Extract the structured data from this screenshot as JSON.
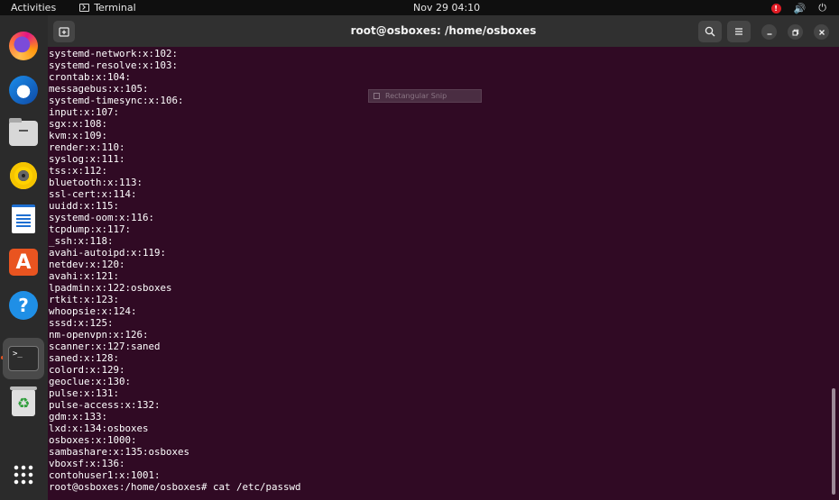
{
  "topbar": {
    "activities": "Activities",
    "app_name": "Terminal",
    "clock": "Nov 29  04:10",
    "tray_alert": "!",
    "volume_symbol": "🔊",
    "power_symbol": "⏻"
  },
  "dock": {
    "items": [
      {
        "name": "Firefox"
      },
      {
        "name": "Thunderbird"
      },
      {
        "name": "Files"
      },
      {
        "name": "Rhythmbox"
      },
      {
        "name": "LibreOffice Writer"
      },
      {
        "name": "Ubuntu Software",
        "glyph": "A"
      },
      {
        "name": "Help",
        "glyph": "?"
      },
      {
        "name": "Terminal",
        "glyph": ">_",
        "active": true
      },
      {
        "name": "Trash",
        "glyph": "♻"
      },
      {
        "name": "Show Applications"
      }
    ]
  },
  "window": {
    "title": "root@osboxes: /home/osboxes",
    "lines": [
      "systemd-network:x:102:",
      "systemd-resolve:x:103:",
      "crontab:x:104:",
      "messagebus:x:105:",
      "systemd-timesync:x:106:",
      "input:x:107:",
      "sgx:x:108:",
      "kvm:x:109:",
      "render:x:110:",
      "syslog:x:111:",
      "tss:x:112:",
      "bluetooth:x:113:",
      "ssl-cert:x:114:",
      "uuidd:x:115:",
      "systemd-oom:x:116:",
      "tcpdump:x:117:",
      "_ssh:x:118:",
      "avahi-autoipd:x:119:",
      "netdev:x:120:",
      "avahi:x:121:",
      "lpadmin:x:122:osboxes",
      "rtkit:x:123:",
      "whoopsie:x:124:",
      "sssd:x:125:",
      "nm-openvpn:x:126:",
      "scanner:x:127:saned",
      "saned:x:128:",
      "colord:x:129:",
      "geoclue:x:130:",
      "pulse:x:131:",
      "pulse-access:x:132:",
      "gdm:x:133:",
      "lxd:x:134:osboxes",
      "osboxes:x:1000:",
      "sambashare:x:135:osboxes",
      "vboxsf:x:136:",
      "contohuser1:x:1001:",
      "root@osboxes:/home/osboxes# cat /etc/passwd"
    ],
    "snip_label": "Rectangular Snip"
  },
  "colors": {
    "terminal_bg": "#300a24",
    "header_bg": "#303030",
    "dock_bg": "#2b2b2b",
    "accent": "#e95420"
  }
}
